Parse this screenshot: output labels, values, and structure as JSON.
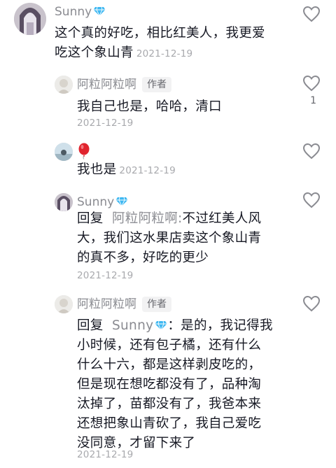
{
  "comments": [
    {
      "user": "Sunny",
      "text_line1": "这个真的好吃，相比红美人，我更爱",
      "text_line2": "吃这个象山青",
      "time": "2021-12-19"
    },
    {
      "user": "阿粒阿粒啊",
      "badge": "作者",
      "text": "我自己也是，哈哈，清口",
      "time": "2021-12-19",
      "likes": "1"
    },
    {
      "user_emoji": "🎈",
      "text": "我也是",
      "time": "2021-12-19"
    },
    {
      "user": "Sunny",
      "reply_prefix": "回复",
      "reply_to": "阿粒阿粒啊:",
      "line1": "不过红美人风",
      "line2": "大，我们这水果店卖这个象山青",
      "line3": "的真不多，好吃的更少",
      "time": "2021-12-19"
    },
    {
      "user": "阿粒阿粒啊",
      "badge": "作者",
      "reply_prefix": "回复",
      "reply_to": "Sunny",
      "line1": "：是的，我记得我",
      "line2": "小时候，还有包子橘，还有什么",
      "line3": "什么十六，都是这样剥皮吃的，",
      "line4": "但是现在想吃都没有了，品种淘",
      "line5": "汰掉了，苗都没有了，我爸本来",
      "line6": "还想把象山青砍了，我自己爱吃",
      "line7": "没同意，才留下来了",
      "time": "2021-12-19"
    }
  ],
  "icons": {
    "like": "heart-outline-icon",
    "verified": "diamond-icon",
    "balloon": "red-balloon-emoji"
  },
  "colors": {
    "name": "#8a8b91",
    "text": "#161823",
    "time": "#a8a9ad",
    "gem": "#3fb8f2"
  }
}
